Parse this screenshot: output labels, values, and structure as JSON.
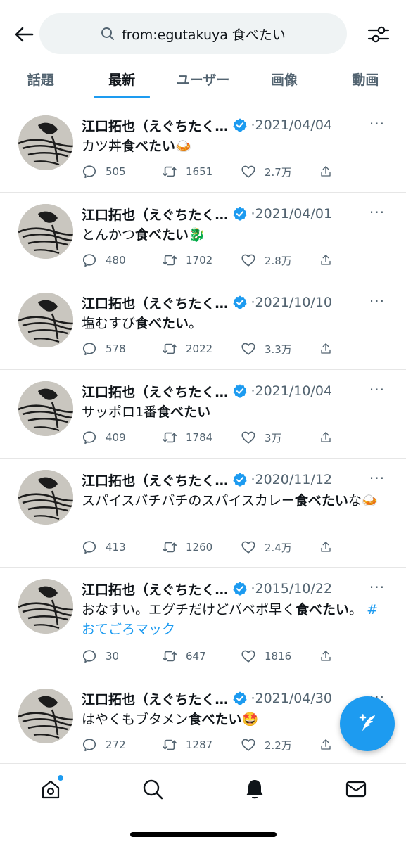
{
  "search": {
    "query": "from:egutakuya 食べたい"
  },
  "tabs": [
    {
      "label": "話題",
      "active": false
    },
    {
      "label": "最新",
      "active": true
    },
    {
      "label": "ユーザー",
      "active": false
    },
    {
      "label": "画像",
      "active": false
    },
    {
      "label": "動画",
      "active": false
    }
  ],
  "tweets": [
    {
      "name": "江口拓也（えぐちたく…",
      "date": "2021/04/04",
      "text_plain": "カツ丼",
      "text_bold": "食べたい",
      "text_after": "",
      "emoji": "🍛",
      "replies": "505",
      "retweets": "1651",
      "likes": "2.7万"
    },
    {
      "name": "江口拓也（えぐちたく…",
      "date": "2021/04/01",
      "text_plain": "とんかつ",
      "text_bold": "食べたい",
      "text_after": "",
      "emoji": "🐉",
      "replies": "480",
      "retweets": "1702",
      "likes": "2.8万"
    },
    {
      "name": "江口拓也（えぐちたく…",
      "date": "2021/10/10",
      "text_plain": "塩むすび",
      "text_bold": "食べたい",
      "text_after": "。",
      "emoji": "",
      "replies": "578",
      "retweets": "2022",
      "likes": "3.3万"
    },
    {
      "name": "江口拓也（えぐちたく…",
      "date": "2021/10/04",
      "text_plain": "サッポロ1番",
      "text_bold": "食べたい",
      "text_after": "",
      "emoji": "",
      "replies": "409",
      "retweets": "1784",
      "likes": "3万"
    },
    {
      "name": "江口拓也（えぐちたく…",
      "date": "2020/11/12",
      "text_plain": "スパイスバチバチのスパイスカレー",
      "text_bold": "食べたい",
      "text_after": "な",
      "emoji": "🍛",
      "replies": "413",
      "retweets": "1260",
      "likes": "2.4万"
    },
    {
      "name": "江口拓也（えぐちたく…",
      "date": "2015/10/22",
      "text_plain": "おなすい。エグチだけどバベポ早く",
      "text_bold": "食べたい",
      "text_after": "。",
      "hashtag": "#おてごろマック",
      "emoji": "",
      "replies": "30",
      "retweets": "647",
      "likes": "1816"
    },
    {
      "name": "江口拓也（えぐちたく…",
      "date": "2021/04/30",
      "text_plain": "はやくもブタメン",
      "text_bold": "食べたい",
      "text_after": "",
      "emoji": "🤩",
      "replies": "272",
      "retweets": "1287",
      "likes": "2.2万"
    }
  ],
  "more_glyph": "···",
  "date_sep": "·",
  "colors": {
    "accent": "#1d9bf0",
    "text": "#0f1419",
    "muted": "#536471"
  },
  "nav_icons": [
    "home-icon",
    "search-icon",
    "bell-icon",
    "mail-icon"
  ]
}
